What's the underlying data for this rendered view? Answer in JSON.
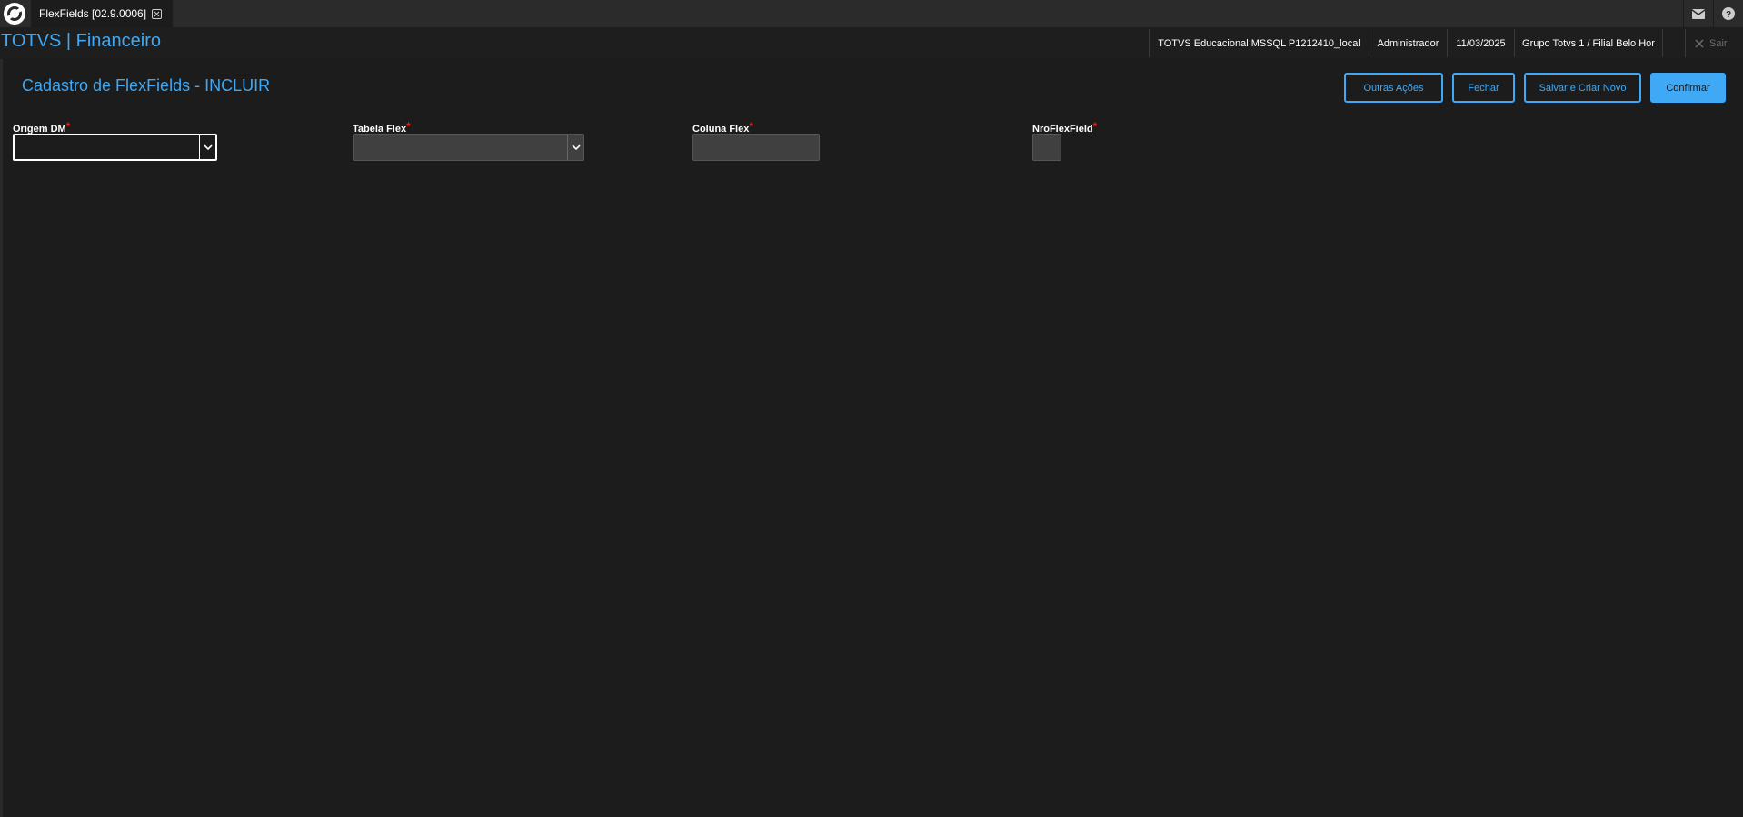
{
  "topbar": {
    "tab_label": "FlexFields [02.9.0006]",
    "icons": [
      "totvs-logo-icon",
      "close-tab-icon",
      "mail-icon",
      "help-icon"
    ]
  },
  "appbar": {
    "title": "TOTVS | Financeiro",
    "context": {
      "database": "TOTVS Educacional MSSQL P1212410_local",
      "user": "Administrador",
      "date": "11/03/2025",
      "branch": "Grupo Totvs 1 / Filial Belo Hor"
    },
    "logout_label": "Sair"
  },
  "form": {
    "title": "Cadastro de FlexFields - INCLUIR",
    "actions": {
      "other_actions": "Outras Ações",
      "close": "Fechar",
      "save_new": "Salvar e Criar Novo",
      "confirm": "Confirmar"
    },
    "fields": {
      "origem_label": "Origem DM",
      "tabela_label": "Tabela Flex",
      "coluna_label": "Coluna Flex",
      "nro_label": "NroFlexField",
      "required_mark": "*",
      "origem_value": "",
      "tabela_value": "",
      "coluna_value": "",
      "nro_value": ""
    }
  },
  "colors": {
    "accent": "#3fa9f5",
    "background": "#1c1c1c",
    "required": "#e02020"
  }
}
